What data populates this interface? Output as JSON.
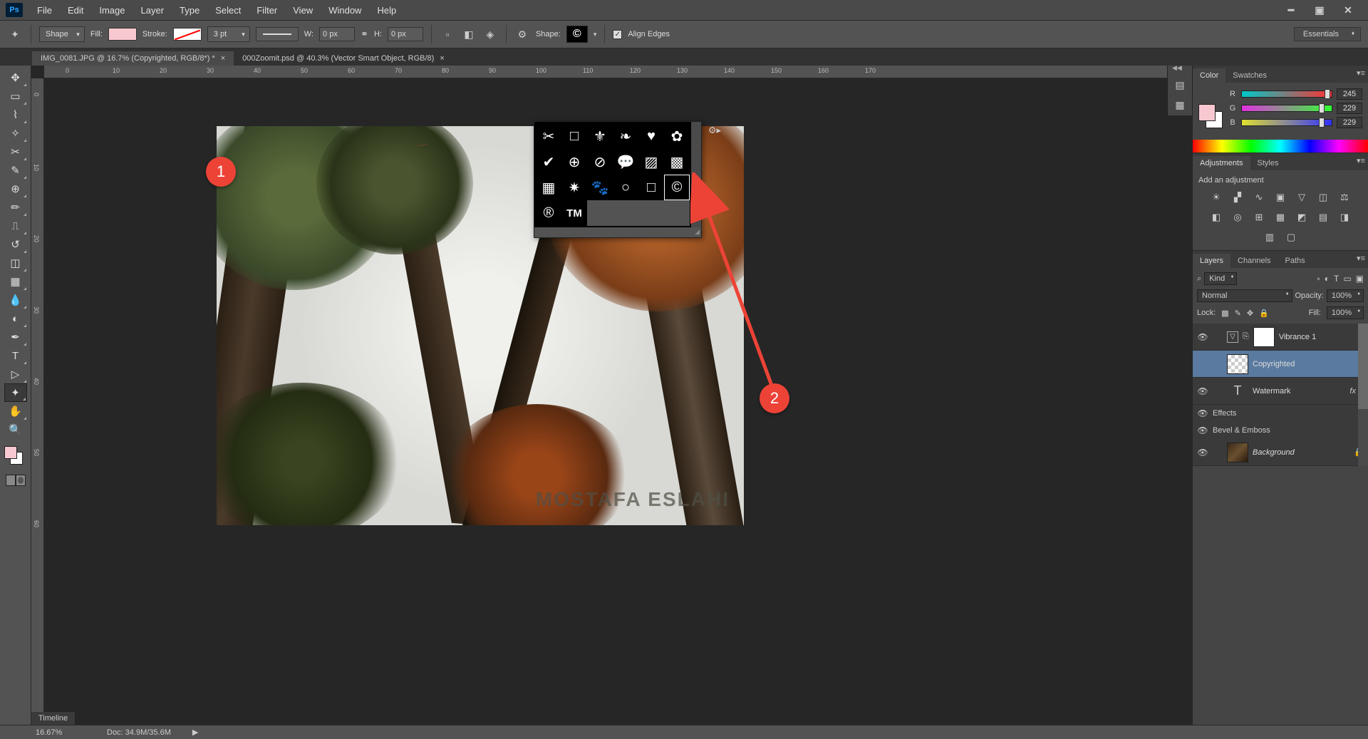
{
  "menu": {
    "file": "File",
    "edit": "Edit",
    "image": "Image",
    "layer": "Layer",
    "type": "Type",
    "select": "Select",
    "filter": "Filter",
    "view": "View",
    "window": "Window",
    "help": "Help"
  },
  "options": {
    "tool_mode": "Shape",
    "fill_label": "Fill:",
    "stroke_label": "Stroke:",
    "stroke_width": "3 pt",
    "w_label": "W:",
    "w_val": "0 px",
    "h_label": "H:",
    "h_val": "0 px",
    "shape_label": "Shape:",
    "shape_glyph": "©",
    "align_edges": "Align Edges",
    "workspace": "Essentials"
  },
  "tabs": {
    "tab1": "IMG_0081.JPG @ 16.7% (Copyrighted, RGB/8*) *",
    "tab2": "000Zoomit.psd @ 40.3% (Vector Smart Object, RGB/8)"
  },
  "ruler_marks": [
    "0",
    "10",
    "20",
    "30",
    "40",
    "50",
    "60",
    "70",
    "80",
    "90",
    "100",
    "110",
    "120",
    "130",
    "140",
    "150",
    "160",
    "170"
  ],
  "ruler_v": [
    "0",
    "10",
    "20",
    "30",
    "40",
    "50",
    "60"
  ],
  "watermark": "MOSTAFA ESLAHI",
  "annotations": {
    "one": "1",
    "two": "2"
  },
  "panels": {
    "color": {
      "tab": "Color",
      "swatches": "Swatches",
      "r_lbl": "R",
      "g_lbl": "G",
      "b_lbl": "B",
      "r": "245",
      "g": "229",
      "b": "229"
    },
    "adjustments": {
      "tab": "Adjustments",
      "styles": "Styles",
      "heading": "Add an adjustment"
    },
    "layers": {
      "tab": "Layers",
      "channels": "Channels",
      "paths": "Paths",
      "filter": "Kind",
      "blend": "Normal",
      "opacity_lbl": "Opacity:",
      "opacity": "100%",
      "lock_lbl": "Lock:",
      "fill_lbl": "Fill:",
      "fill": "100%",
      "l1": "Vibrance 1",
      "l2": "Copyrighted",
      "l3": "Watermark",
      "l3fx": "fx",
      "l3a": "Effects",
      "l3b": "Bevel & Emboss",
      "l4": "Background"
    }
  },
  "status": {
    "zoom": "16.67%",
    "doc": "Doc: 34.9M/35.6M",
    "timeline": "Timeline"
  },
  "shapes": {
    "reg": "®",
    "tm": "TM",
    "copyright": "©"
  }
}
